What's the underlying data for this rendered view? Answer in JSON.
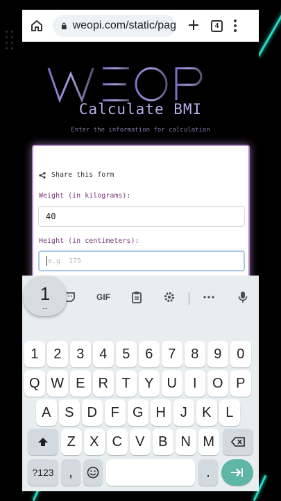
{
  "browser": {
    "url": "weopi.com/static/pag",
    "tab_count": "4",
    "icons": [
      "home-icon",
      "lock-icon",
      "plus-icon",
      "tabs-icon",
      "menu-icon"
    ]
  },
  "page": {
    "logo_text": "WEOPI",
    "title": "Calculate BMI",
    "subtitle": "Enter the information for calculation"
  },
  "form": {
    "share_label": "Share this form",
    "weight_label": "Weight (in kilograms):",
    "weight_value": "40",
    "height_label": "Height (in centimeters):",
    "height_placeholder": "e.g. 175"
  },
  "keyboard": {
    "popup_key": "1",
    "popup_more": "...",
    "gif_label": "GIF",
    "number_row": [
      "1",
      "2",
      "3",
      "4",
      "5",
      "6",
      "7",
      "8",
      "9",
      "0"
    ],
    "row1": [
      "Q",
      "W",
      "E",
      "R",
      "T",
      "Y",
      "U",
      "I",
      "O",
      "P"
    ],
    "row2": [
      "A",
      "S",
      "D",
      "F",
      "G",
      "H",
      "J",
      "K",
      "L"
    ],
    "row3": [
      "Z",
      "X",
      "C",
      "V",
      "B",
      "N",
      "M"
    ],
    "symbols_label": "?123",
    "comma_label": ",",
    "period_label": "."
  },
  "colors": {
    "accent_title": "#b9aee8",
    "form_border": "#b48ad0",
    "label": "#7a3b7a",
    "enter_key": "#5fb5a6",
    "neon": "#26d9c5"
  }
}
